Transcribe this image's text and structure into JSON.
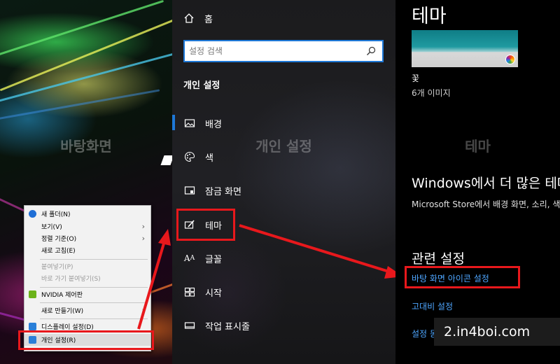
{
  "desktop": {
    "panel_caption": "바탕화면",
    "context_menu": {
      "items": [
        {
          "label": "새 폴더(N)",
          "icon": "new-folder-icon",
          "disabled": false
        },
        {
          "label": "보기(V)",
          "submenu": true,
          "disabled": false
        },
        {
          "label": "정렬 기준(O)",
          "submenu": true,
          "disabled": false
        },
        {
          "label": "새로 고침(E)",
          "disabled": false
        },
        {
          "label": "붙여넣기(P)",
          "disabled": true
        },
        {
          "label": "바로 가기 붙여넣기(S)",
          "disabled": true
        },
        {
          "label": "NVIDIA 제어판",
          "icon": "nvidia-icon",
          "disabled": false
        },
        {
          "label": "새로 만들기(W)",
          "submenu": true,
          "disabled": false
        },
        {
          "label": "디스플레이 설정(D)",
          "icon": "display-icon",
          "disabled": false
        },
        {
          "label": "개인 설정(R)",
          "icon": "personalize-icon",
          "disabled": false
        }
      ]
    }
  },
  "settings": {
    "home_label": "홈",
    "search_placeholder": "설정 검색",
    "section_title": "개인 설정",
    "panel_caption": "개인 설정",
    "nav_items": [
      {
        "label": "배경",
        "icon": "picture-icon",
        "selected": true
      },
      {
        "label": "색",
        "icon": "palette-icon"
      },
      {
        "label": "잠금 화면",
        "icon": "lock-screen-icon"
      },
      {
        "label": "테마",
        "icon": "theme-brush-icon",
        "highlighted": true
      },
      {
        "label": "글꼴",
        "icon": "font-icon"
      },
      {
        "label": "시작",
        "icon": "start-grid-icon"
      },
      {
        "label": "작업 표시줄",
        "icon": "taskbar-icon"
      }
    ]
  },
  "themes_page": {
    "title": "테마",
    "theme_name": "꽃",
    "theme_count": "6개 이미지",
    "panel_caption": "테마",
    "more_heading": "Windows에서 더 많은 테마 보기",
    "more_desc": "Microsoft Store에서 배경 화면, 소리, 색을 결합한 무료 테마를 다운로드하세요",
    "related_heading": "관련 설정",
    "related_links": [
      "바탕 화면 아이콘 설정",
      "고대비 설정",
      "설정 동기화"
    ]
  },
  "watermark": "2.in4boi.com",
  "colors": {
    "accent": "#1e78d7",
    "link": "#4ea6ff",
    "highlight_red": "#e8181c"
  }
}
